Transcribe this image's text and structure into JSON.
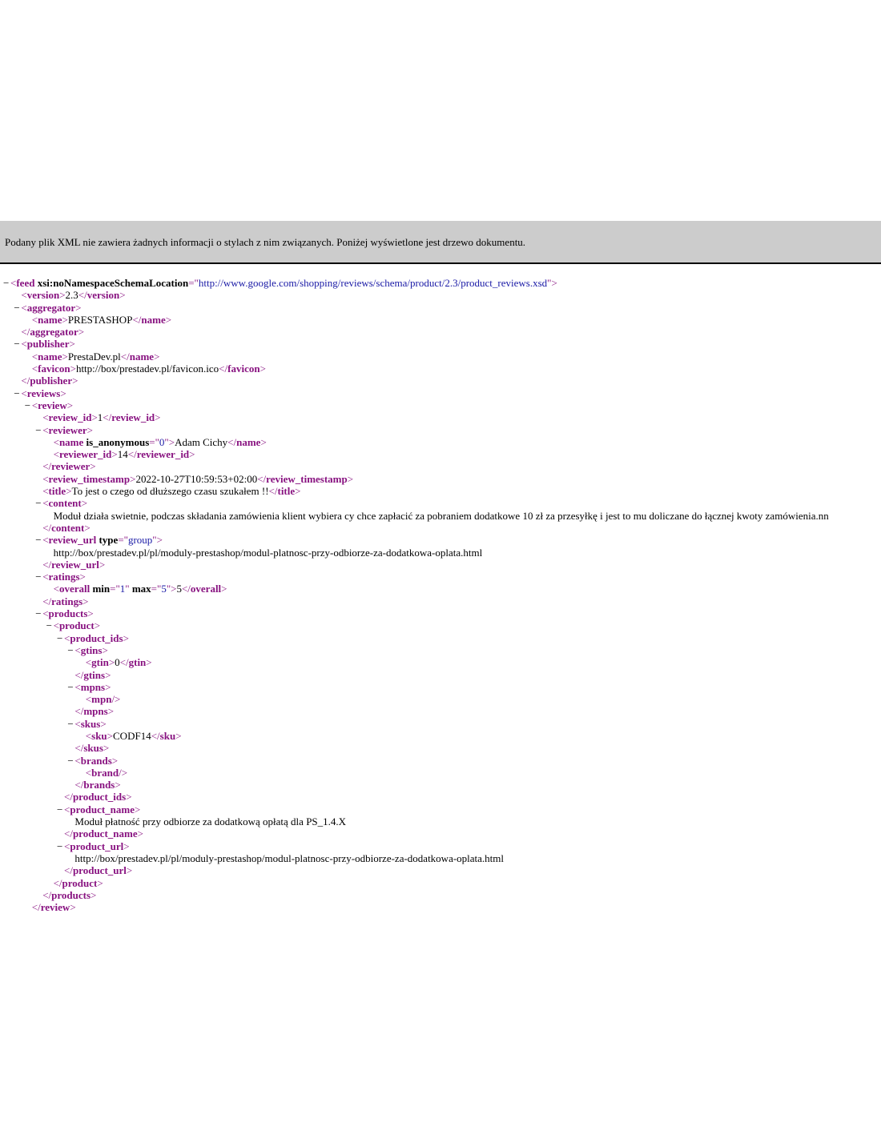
{
  "banner": {
    "message": "Podany plik XML nie zawiera żadnych informacji o stylach z nim związanych. Poniżej wyświetlone jest drzewo dokumentu."
  },
  "colors": {
    "tag": "#881280",
    "attr_value": "#1a1aa6",
    "banner_bg": "#cccccc"
  },
  "fold_symbol": "−",
  "lines": [
    {
      "indent": 0,
      "fold": true,
      "parts": [
        [
          "br",
          "<"
        ],
        [
          "tg",
          "feed"
        ],
        [
          "sp",
          " "
        ],
        [
          "an",
          "xsi:noNamespaceSchemaLocation"
        ],
        [
          "br",
          "=\""
        ],
        [
          "av",
          "http://www.google.com/shopping/reviews/schema/product/2.3/product_reviews.xsd"
        ],
        [
          "br",
          "\">"
        ]
      ]
    },
    {
      "indent": 1,
      "fold": false,
      "parts": [
        [
          "br",
          "<"
        ],
        [
          "tg",
          "version"
        ],
        [
          "br",
          ">"
        ],
        [
          "tx",
          "2.3"
        ],
        [
          "br",
          "</"
        ],
        [
          "tg",
          "version"
        ],
        [
          "br",
          ">"
        ]
      ]
    },
    {
      "indent": 1,
      "fold": true,
      "parts": [
        [
          "br",
          "<"
        ],
        [
          "tg",
          "aggregator"
        ],
        [
          "br",
          ">"
        ]
      ]
    },
    {
      "indent": 2,
      "fold": false,
      "parts": [
        [
          "br",
          "<"
        ],
        [
          "tg",
          "name"
        ],
        [
          "br",
          ">"
        ],
        [
          "tx",
          "PRESTASHOP"
        ],
        [
          "br",
          "</"
        ],
        [
          "tg",
          "name"
        ],
        [
          "br",
          ">"
        ]
      ]
    },
    {
      "indent": 1,
      "fold": false,
      "parts": [
        [
          "br",
          "</"
        ],
        [
          "tg",
          "aggregator"
        ],
        [
          "br",
          ">"
        ]
      ]
    },
    {
      "indent": 1,
      "fold": true,
      "parts": [
        [
          "br",
          "<"
        ],
        [
          "tg",
          "publisher"
        ],
        [
          "br",
          ">"
        ]
      ]
    },
    {
      "indent": 2,
      "fold": false,
      "parts": [
        [
          "br",
          "<"
        ],
        [
          "tg",
          "name"
        ],
        [
          "br",
          ">"
        ],
        [
          "tx",
          "PrestaDev.pl"
        ],
        [
          "br",
          "</"
        ],
        [
          "tg",
          "name"
        ],
        [
          "br",
          ">"
        ]
      ]
    },
    {
      "indent": 2,
      "fold": false,
      "parts": [
        [
          "br",
          "<"
        ],
        [
          "tg",
          "favicon"
        ],
        [
          "br",
          ">"
        ],
        [
          "tx",
          "http://box/prestadev.pl/favicon.ico"
        ],
        [
          "br",
          "</"
        ],
        [
          "tg",
          "favicon"
        ],
        [
          "br",
          ">"
        ]
      ]
    },
    {
      "indent": 1,
      "fold": false,
      "parts": [
        [
          "br",
          "</"
        ],
        [
          "tg",
          "publisher"
        ],
        [
          "br",
          ">"
        ]
      ]
    },
    {
      "indent": 1,
      "fold": true,
      "parts": [
        [
          "br",
          "<"
        ],
        [
          "tg",
          "reviews"
        ],
        [
          "br",
          ">"
        ]
      ]
    },
    {
      "indent": 2,
      "fold": true,
      "parts": [
        [
          "br",
          "<"
        ],
        [
          "tg",
          "review"
        ],
        [
          "br",
          ">"
        ]
      ]
    },
    {
      "indent": 3,
      "fold": false,
      "parts": [
        [
          "br",
          "<"
        ],
        [
          "tg",
          "review_id"
        ],
        [
          "br",
          ">"
        ],
        [
          "tx",
          "1"
        ],
        [
          "br",
          "</"
        ],
        [
          "tg",
          "review_id"
        ],
        [
          "br",
          ">"
        ]
      ]
    },
    {
      "indent": 3,
      "fold": true,
      "parts": [
        [
          "br",
          "<"
        ],
        [
          "tg",
          "reviewer"
        ],
        [
          "br",
          ">"
        ]
      ]
    },
    {
      "indent": 4,
      "fold": false,
      "parts": [
        [
          "br",
          "<"
        ],
        [
          "tg",
          "name"
        ],
        [
          "sp",
          " "
        ],
        [
          "an",
          "is_anonymous"
        ],
        [
          "br",
          "=\""
        ],
        [
          "av",
          "0"
        ],
        [
          "br",
          "\">"
        ],
        [
          "tx",
          "Adam Cichy"
        ],
        [
          "br",
          "</"
        ],
        [
          "tg",
          "name"
        ],
        [
          "br",
          ">"
        ]
      ]
    },
    {
      "indent": 4,
      "fold": false,
      "parts": [
        [
          "br",
          "<"
        ],
        [
          "tg",
          "reviewer_id"
        ],
        [
          "br",
          ">"
        ],
        [
          "tx",
          "14"
        ],
        [
          "br",
          "</"
        ],
        [
          "tg",
          "reviewer_id"
        ],
        [
          "br",
          ">"
        ]
      ]
    },
    {
      "indent": 3,
      "fold": false,
      "parts": [
        [
          "br",
          "</"
        ],
        [
          "tg",
          "reviewer"
        ],
        [
          "br",
          ">"
        ]
      ]
    },
    {
      "indent": 3,
      "fold": false,
      "parts": [
        [
          "br",
          "<"
        ],
        [
          "tg",
          "review_timestamp"
        ],
        [
          "br",
          ">"
        ],
        [
          "tx",
          "2022-10-27T10:59:53+02:00"
        ],
        [
          "br",
          "</"
        ],
        [
          "tg",
          "review_timestamp"
        ],
        [
          "br",
          ">"
        ]
      ]
    },
    {
      "indent": 3,
      "fold": false,
      "parts": [
        [
          "br",
          "<"
        ],
        [
          "tg",
          "title"
        ],
        [
          "br",
          ">"
        ],
        [
          "tx",
          "To jest o czego od dłuższego czasu szukałem !!"
        ],
        [
          "br",
          "</"
        ],
        [
          "tg",
          "title"
        ],
        [
          "br",
          ">"
        ]
      ]
    },
    {
      "indent": 3,
      "fold": true,
      "parts": [
        [
          "br",
          "<"
        ],
        [
          "tg",
          "content"
        ],
        [
          "br",
          ">"
        ]
      ]
    },
    {
      "indent": 4,
      "fold": false,
      "parts": [
        [
          "tx",
          "Moduł działa swietnie, podczas składania zamówienia klient wybiera cy chce zapłacić za pobraniem dodatkowe 10 zł za przesyłkę i jest to mu doliczane do łącznej kwoty zamówienia.nn"
        ]
      ]
    },
    {
      "indent": 3,
      "fold": false,
      "parts": [
        [
          "br",
          "</"
        ],
        [
          "tg",
          "content"
        ],
        [
          "br",
          ">"
        ]
      ]
    },
    {
      "indent": 3,
      "fold": true,
      "parts": [
        [
          "br",
          "<"
        ],
        [
          "tg",
          "review_url"
        ],
        [
          "sp",
          " "
        ],
        [
          "an",
          "type"
        ],
        [
          "br",
          "=\""
        ],
        [
          "av",
          "group"
        ],
        [
          "br",
          "\">"
        ]
      ]
    },
    {
      "indent": 4,
      "fold": false,
      "parts": [
        [
          "tx",
          "http://box/prestadev.pl/pl/moduly-prestashop/modul-platnosc-przy-odbiorze-za-dodatkowa-oplata.html"
        ]
      ]
    },
    {
      "indent": 3,
      "fold": false,
      "parts": [
        [
          "br",
          "</"
        ],
        [
          "tg",
          "review_url"
        ],
        [
          "br",
          ">"
        ]
      ]
    },
    {
      "indent": 3,
      "fold": true,
      "parts": [
        [
          "br",
          "<"
        ],
        [
          "tg",
          "ratings"
        ],
        [
          "br",
          ">"
        ]
      ]
    },
    {
      "indent": 4,
      "fold": false,
      "parts": [
        [
          "br",
          "<"
        ],
        [
          "tg",
          "overall"
        ],
        [
          "sp",
          " "
        ],
        [
          "an",
          "min"
        ],
        [
          "br",
          "=\""
        ],
        [
          "av",
          "1"
        ],
        [
          "br",
          "\""
        ],
        [
          "sp",
          " "
        ],
        [
          "an",
          "max"
        ],
        [
          "br",
          "=\""
        ],
        [
          "av",
          "5"
        ],
        [
          "br",
          "\">"
        ],
        [
          "tx",
          "5"
        ],
        [
          "br",
          "</"
        ],
        [
          "tg",
          "overall"
        ],
        [
          "br",
          ">"
        ]
      ]
    },
    {
      "indent": 3,
      "fold": false,
      "parts": [
        [
          "br",
          "</"
        ],
        [
          "tg",
          "ratings"
        ],
        [
          "br",
          ">"
        ]
      ]
    },
    {
      "indent": 3,
      "fold": true,
      "parts": [
        [
          "br",
          "<"
        ],
        [
          "tg",
          "products"
        ],
        [
          "br",
          ">"
        ]
      ]
    },
    {
      "indent": 4,
      "fold": true,
      "parts": [
        [
          "br",
          "<"
        ],
        [
          "tg",
          "product"
        ],
        [
          "br",
          ">"
        ]
      ]
    },
    {
      "indent": 5,
      "fold": true,
      "parts": [
        [
          "br",
          "<"
        ],
        [
          "tg",
          "product_ids"
        ],
        [
          "br",
          ">"
        ]
      ]
    },
    {
      "indent": 6,
      "fold": true,
      "parts": [
        [
          "br",
          "<"
        ],
        [
          "tg",
          "gtins"
        ],
        [
          "br",
          ">"
        ]
      ]
    },
    {
      "indent": 7,
      "fold": false,
      "parts": [
        [
          "br",
          "<"
        ],
        [
          "tg",
          "gtin"
        ],
        [
          "br",
          ">"
        ],
        [
          "tx",
          "0"
        ],
        [
          "br",
          "</"
        ],
        [
          "tg",
          "gtin"
        ],
        [
          "br",
          ">"
        ]
      ]
    },
    {
      "indent": 6,
      "fold": false,
      "parts": [
        [
          "br",
          "</"
        ],
        [
          "tg",
          "gtins"
        ],
        [
          "br",
          ">"
        ]
      ]
    },
    {
      "indent": 6,
      "fold": true,
      "parts": [
        [
          "br",
          "<"
        ],
        [
          "tg",
          "mpns"
        ],
        [
          "br",
          ">"
        ]
      ]
    },
    {
      "indent": 7,
      "fold": false,
      "parts": [
        [
          "br",
          "<"
        ],
        [
          "tg",
          "mpn"
        ],
        [
          "br",
          "/>"
        ]
      ]
    },
    {
      "indent": 6,
      "fold": false,
      "parts": [
        [
          "br",
          "</"
        ],
        [
          "tg",
          "mpns"
        ],
        [
          "br",
          ">"
        ]
      ]
    },
    {
      "indent": 6,
      "fold": true,
      "parts": [
        [
          "br",
          "<"
        ],
        [
          "tg",
          "skus"
        ],
        [
          "br",
          ">"
        ]
      ]
    },
    {
      "indent": 7,
      "fold": false,
      "parts": [
        [
          "br",
          "<"
        ],
        [
          "tg",
          "sku"
        ],
        [
          "br",
          ">"
        ],
        [
          "tx",
          "CODF14"
        ],
        [
          "br",
          "</"
        ],
        [
          "tg",
          "sku"
        ],
        [
          "br",
          ">"
        ]
      ]
    },
    {
      "indent": 6,
      "fold": false,
      "parts": [
        [
          "br",
          "</"
        ],
        [
          "tg",
          "skus"
        ],
        [
          "br",
          ">"
        ]
      ]
    },
    {
      "indent": 6,
      "fold": true,
      "parts": [
        [
          "br",
          "<"
        ],
        [
          "tg",
          "brands"
        ],
        [
          "br",
          ">"
        ]
      ]
    },
    {
      "indent": 7,
      "fold": false,
      "parts": [
        [
          "br",
          "<"
        ],
        [
          "tg",
          "brand"
        ],
        [
          "br",
          "/>"
        ]
      ]
    },
    {
      "indent": 6,
      "fold": false,
      "parts": [
        [
          "br",
          "</"
        ],
        [
          "tg",
          "brands"
        ],
        [
          "br",
          ">"
        ]
      ]
    },
    {
      "indent": 5,
      "fold": false,
      "parts": [
        [
          "br",
          "</"
        ],
        [
          "tg",
          "product_ids"
        ],
        [
          "br",
          ">"
        ]
      ]
    },
    {
      "indent": 5,
      "fold": true,
      "parts": [
        [
          "br",
          "<"
        ],
        [
          "tg",
          "product_name"
        ],
        [
          "br",
          ">"
        ]
      ]
    },
    {
      "indent": 6,
      "fold": false,
      "parts": [
        [
          "tx",
          "Moduł płatność przy odbiorze za dodatkową opłatą dla PS_1.4.X"
        ]
      ]
    },
    {
      "indent": 5,
      "fold": false,
      "parts": [
        [
          "br",
          "</"
        ],
        [
          "tg",
          "product_name"
        ],
        [
          "br",
          ">"
        ]
      ]
    },
    {
      "indent": 5,
      "fold": true,
      "parts": [
        [
          "br",
          "<"
        ],
        [
          "tg",
          "product_url"
        ],
        [
          "br",
          ">"
        ]
      ]
    },
    {
      "indent": 6,
      "fold": false,
      "parts": [
        [
          "tx",
          "http://box/prestadev.pl/pl/moduly-prestashop/modul-platnosc-przy-odbiorze-za-dodatkowa-oplata.html"
        ]
      ]
    },
    {
      "indent": 5,
      "fold": false,
      "parts": [
        [
          "br",
          "</"
        ],
        [
          "tg",
          "product_url"
        ],
        [
          "br",
          ">"
        ]
      ]
    },
    {
      "indent": 4,
      "fold": false,
      "parts": [
        [
          "br",
          "</"
        ],
        [
          "tg",
          "product"
        ],
        [
          "br",
          ">"
        ]
      ]
    },
    {
      "indent": 3,
      "fold": false,
      "parts": [
        [
          "br",
          "</"
        ],
        [
          "tg",
          "products"
        ],
        [
          "br",
          ">"
        ]
      ]
    },
    {
      "indent": 2,
      "fold": false,
      "parts": [
        [
          "br",
          "</"
        ],
        [
          "tg",
          "review"
        ],
        [
          "br",
          ">"
        ]
      ]
    }
  ]
}
